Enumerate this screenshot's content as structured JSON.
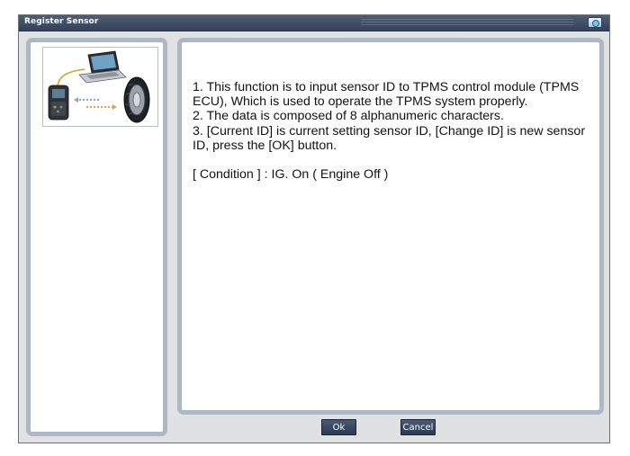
{
  "window": {
    "title": "Register Sensor",
    "system_icon": "camera-icon"
  },
  "illustration": {
    "icons": [
      "laptop-icon",
      "scan-tool-icon",
      "tire-icon"
    ]
  },
  "description": {
    "lines": [
      "1. This function is to input sensor ID to TPMS control module (TPMS ECU), Which is used to operate the TPMS system properly.",
      "2. The data is composed of 8 alphanumeric characters.",
      "3. [Current ID] is current setting sensor ID, [Change ID] is new sensor ID, press the [OK] button."
    ],
    "condition": "[ Condition ] : IG. On ( Engine Off )"
  },
  "buttons": {
    "ok_label": "Ok",
    "cancel_label": "Cancel"
  },
  "colors": {
    "titlebar": "#3f4c61",
    "panel_border": "#aeb8c4",
    "button": "#34425c"
  }
}
